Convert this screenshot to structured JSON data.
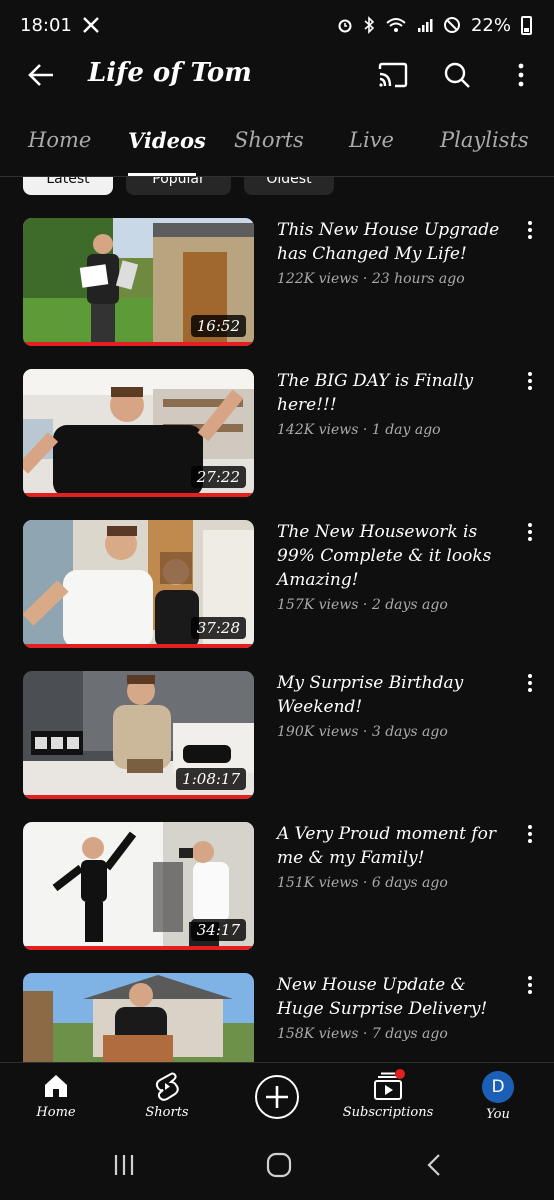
{
  "status_bar": {
    "time": "18:01",
    "battery": "22%",
    "icons": [
      "x-icon",
      "alarm-icon",
      "bluetooth-icon",
      "wifi-icon",
      "signal-icon",
      "do-not-disturb-icon",
      "battery-icon"
    ]
  },
  "app_bar": {
    "title": "Life of Tom",
    "icons": [
      "back-arrow-icon",
      "cast-icon",
      "search-icon",
      "more-vert-icon"
    ]
  },
  "tabs": [
    {
      "label": "Home",
      "active": false
    },
    {
      "label": "Videos",
      "active": true
    },
    {
      "label": "Shorts",
      "active": false
    },
    {
      "label": "Live",
      "active": false
    },
    {
      "label": "Playlists",
      "active": false
    }
  ],
  "chips": [
    {
      "label": "Latest",
      "selected": true
    },
    {
      "label": "Popular",
      "selected": false
    },
    {
      "label": "Oldest",
      "selected": false
    }
  ],
  "videos": [
    {
      "title": "This New House Upgrade has Changed My Life!",
      "views": "122K views",
      "age": "23 hours ago",
      "duration": "16:52"
    },
    {
      "title": "The BIG DAY is Finally here!!!",
      "views": "142K views",
      "age": "1 day ago",
      "duration": "27:22"
    },
    {
      "title": "The New Housework is 99% Complete & it looks Amazing!",
      "views": "157K views",
      "age": "2 days ago",
      "duration": "37:28"
    },
    {
      "title": "My Surprise Birthday Weekend!",
      "views": "190K views",
      "age": "3 days ago",
      "duration": "1:08:17"
    },
    {
      "title": "A Very Proud moment for me & my Family!",
      "views": "151K views",
      "age": "6 days ago",
      "duration": "34:17"
    },
    {
      "title": "New House Update & Huge Surprise Delivery!",
      "views": "158K views",
      "age": "7 days ago",
      "duration": ""
    }
  ],
  "bottom_nav": {
    "home": "Home",
    "shorts": "Shorts",
    "create_icon": "add-circle-icon",
    "subscriptions": "Subscriptions",
    "you": "You",
    "avatar_initial": "D"
  },
  "colors": {
    "background": "#0f0f0f",
    "accent_red": "#e41f1f",
    "secondary_text": "#aaaaaa",
    "avatar_bg": "#1b60b6"
  }
}
